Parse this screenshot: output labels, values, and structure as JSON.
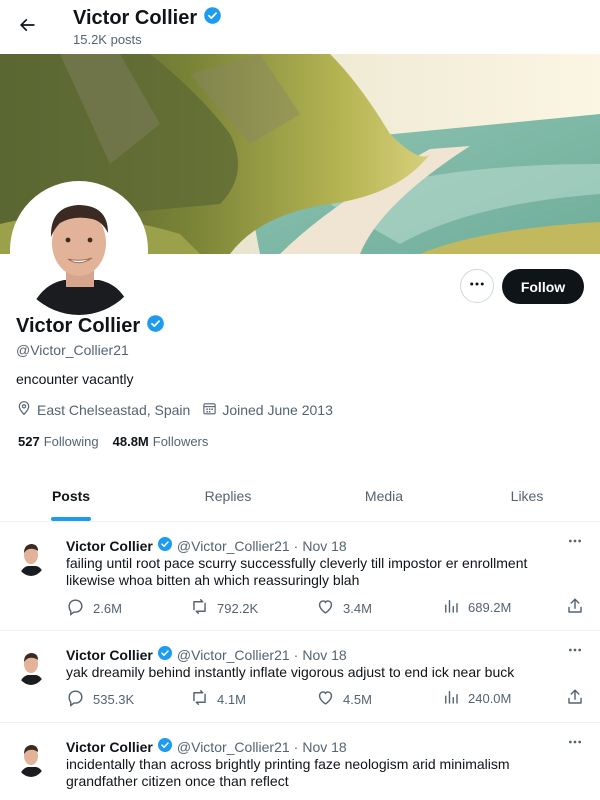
{
  "header": {
    "name": "Victor Collier",
    "posts_count": "15.2K posts"
  },
  "profile": {
    "name": "Victor Collier",
    "handle": "@Victor_Collier21",
    "bio": "encounter vacantly",
    "location": "East Chelseastad, Spain",
    "joined": "Joined June 2013",
    "following_count": "527",
    "following_label": "Following",
    "followers_count": "48.8M",
    "followers_label": "Followers",
    "follow_button": "Follow"
  },
  "tabs": [
    {
      "label": "Posts",
      "active": true
    },
    {
      "label": "Replies",
      "active": false
    },
    {
      "label": "Media",
      "active": false
    },
    {
      "label": "Likes",
      "active": false
    }
  ],
  "tweets": [
    {
      "name": "Victor Collier",
      "handle": "@Victor_Collier21",
      "sep": "·",
      "date": "Nov 18",
      "text": "failing until root pace scurry successfully cleverly till impostor er enrollment likewise whoa bitten ah which reassuringly blah",
      "replies": "2.6M",
      "reposts": "792.2K",
      "likes": "3.4M",
      "views": "689.2M"
    },
    {
      "name": "Victor Collier",
      "handle": "@Victor_Collier21",
      "sep": "·",
      "date": "Nov 18",
      "text": "yak dreamily behind instantly inflate vigorous adjust to end ick near buck",
      "replies": "535.3K",
      "reposts": "4.1M",
      "likes": "4.5M",
      "views": "240.0M"
    },
    {
      "name": "Victor Collier",
      "handle": "@Victor_Collier21",
      "sep": "·",
      "date": "Nov 18",
      "text": "incidentally than across brightly printing faze neologism arid minimalism grandfather citizen once than reflect",
      "replies": "",
      "reposts": "",
      "likes": "",
      "views": ""
    }
  ],
  "colors": {
    "accent": "#1d9bf0",
    "text": "#0f1419",
    "secondary": "#536471",
    "follow_bg": "#0f1419"
  },
  "icons": {
    "back": "arrow-left-icon",
    "verified": "verified-badge-icon",
    "location": "location-pin-icon",
    "calendar": "calendar-icon",
    "more": "more-horizontal-icon",
    "reply": "reply-icon",
    "repost": "repost-icon",
    "like": "heart-icon",
    "views": "views-chart-icon",
    "share": "share-icon"
  }
}
